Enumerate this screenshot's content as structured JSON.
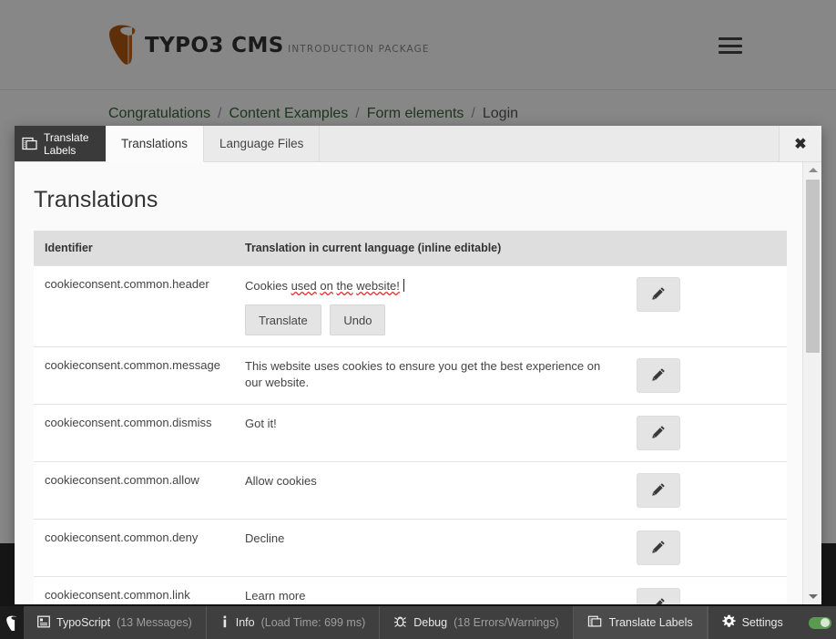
{
  "site": {
    "logo": {
      "title": "TYPO3 CMS",
      "subtitle": "INTRODUCTION PACKAGE",
      "mark_color": "#ff8700"
    },
    "menu_icon": "hamburger-menu-icon",
    "breadcrumb": {
      "separator": "/",
      "items": [
        {
          "label": "Congratulations",
          "current": false
        },
        {
          "label": "Content Examples",
          "current": false
        },
        {
          "label": "Form elements",
          "current": false
        },
        {
          "label": "Login",
          "current": true
        }
      ]
    }
  },
  "modal": {
    "brand_tab": {
      "label": "Translate Labels",
      "icon": "panels-icon"
    },
    "tabs": [
      {
        "label": "Translations",
        "active": true
      },
      {
        "label": "Language Files",
        "active": false
      }
    ],
    "close_label": "✖",
    "title": "Translations",
    "table": {
      "headers": {
        "identifier": "Identifier",
        "translation": "Translation in current language (inline editable)",
        "actions": ""
      },
      "rows": [
        {
          "identifier": "cookieconsent.common.header",
          "value_parts": [
            {
              "text": "Cookies ",
              "misspelled": false
            },
            {
              "text": "used",
              "misspelled": true
            },
            {
              "text": " ",
              "misspelled": false
            },
            {
              "text": "on",
              "misspelled": true
            },
            {
              "text": " ",
              "misspelled": false
            },
            {
              "text": "the",
              "misspelled": true
            },
            {
              "text": " ",
              "misspelled": false
            },
            {
              "text": "website!",
              "misspelled": true
            }
          ],
          "value_plain": "Cookies used on the website!",
          "editing": true,
          "buttons": [
            {
              "label": "Translate",
              "name": "translate-button"
            },
            {
              "label": "Undo",
              "name": "undo-button"
            }
          ],
          "edit_icon": "pencil-icon"
        },
        {
          "identifier": "cookieconsent.common.message",
          "value_plain": "This website uses cookies to ensure you get the best experience on our website.",
          "editing": false,
          "edit_icon": "pencil-icon"
        },
        {
          "identifier": "cookieconsent.common.dismiss",
          "value_plain": "Got it!",
          "editing": false,
          "edit_icon": "pencil-icon"
        },
        {
          "identifier": "cookieconsent.common.allow",
          "value_plain": "Allow cookies",
          "editing": false,
          "edit_icon": "pencil-icon"
        },
        {
          "identifier": "cookieconsent.common.deny",
          "value_plain": "Decline",
          "editing": false,
          "edit_icon": "pencil-icon"
        },
        {
          "identifier": "cookieconsent.common.link",
          "value_plain": "Learn more",
          "editing": false,
          "edit_icon": "pencil-icon"
        }
      ]
    }
  },
  "debug_toolbar": {
    "logo_icon": "typo3-logo-icon",
    "items": [
      {
        "icon": "typoscript-icon",
        "label": "TypoScript",
        "detail": "(13 Messages)",
        "active": false
      },
      {
        "icon": "info-icon",
        "label": "Info",
        "detail": "(Load Time: 699 ms)",
        "active": false
      },
      {
        "icon": "bug-icon",
        "label": "Debug",
        "detail": "(18 Errors/Warnings)",
        "active": false
      },
      {
        "icon": "panels-icon",
        "label": "Translate Labels",
        "detail": "",
        "active": true
      }
    ],
    "settings": {
      "icon": "gear-icon",
      "label": "Settings"
    },
    "toggle": {
      "name": "adminpanel-toggle",
      "state": "on",
      "color": "#5a9a51"
    }
  }
}
